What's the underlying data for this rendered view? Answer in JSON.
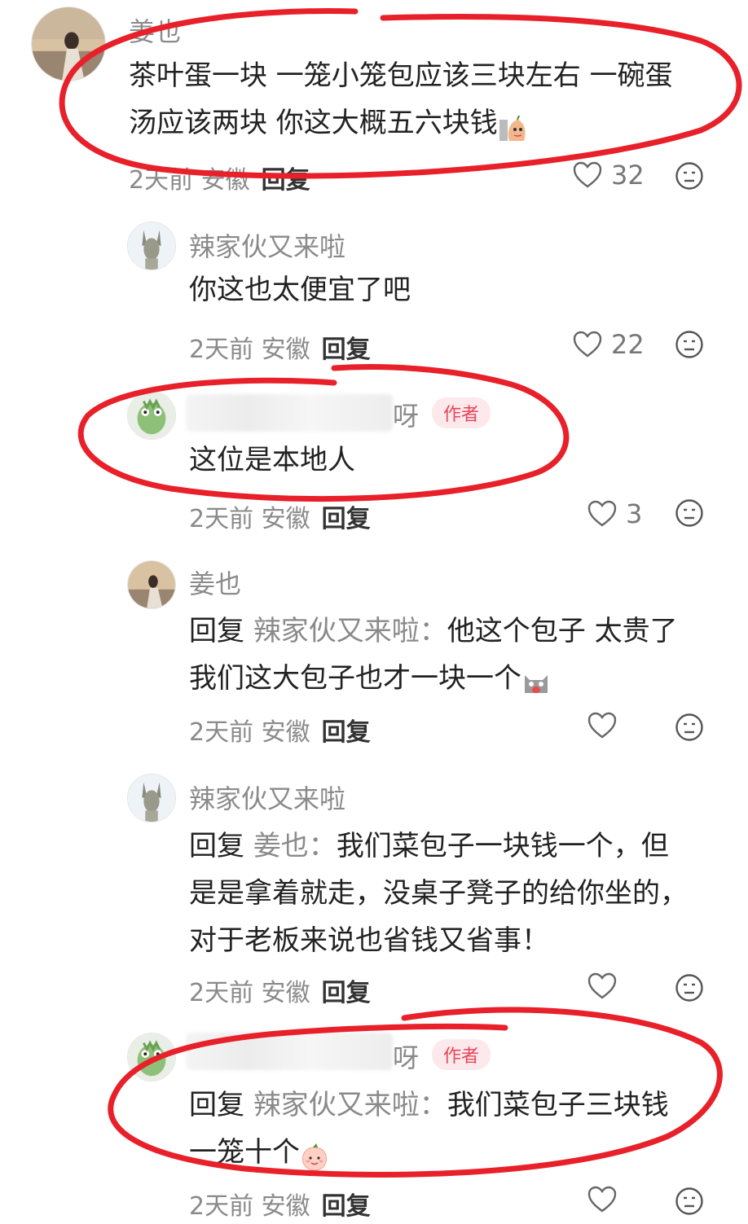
{
  "comments": [
    {
      "username": "姜也",
      "body": [
        "茶叶蛋一块 一笼小笼包应该三块左右 一碗蛋",
        "汤应该两块 你这大概五六块钱"
      ],
      "time": "2天前",
      "location": "安徽",
      "reply_label": "回复",
      "likes": "32",
      "emoji": "pear-emoji"
    },
    {
      "username": "辣家伙又来啦",
      "body": [
        "你这也太便宜了吧"
      ],
      "time": "2天前",
      "location": "安徽",
      "reply_label": "回复",
      "likes": "22"
    },
    {
      "username_suffix": "呀",
      "author_tag": "作者",
      "body": [
        "这位是本地人"
      ],
      "time": "2天前",
      "location": "安徽",
      "reply_label": "回复",
      "likes": "3"
    },
    {
      "username": "姜也",
      "reply_word": "回复",
      "reply_target": "辣家伙又来啦：",
      "body": [
        "他这个包子 太贵了",
        "我们这大包子也才一块一个"
      ],
      "time": "2天前",
      "location": "安徽",
      "reply_label": "回复",
      "likes": "",
      "emoji": "crying-cat-emoji"
    },
    {
      "username": "辣家伙又来啦",
      "reply_word": "回复",
      "reply_target": "姜也：",
      "body": [
        "我们菜包子一块钱一个，但",
        "是是拿着就走，没桌子凳子的给你坐的，",
        "对于老板来说也省钱又省事！"
      ],
      "time": "2天前",
      "location": "安徽",
      "reply_label": "回复",
      "likes": ""
    },
    {
      "username_suffix": "呀",
      "author_tag": "作者",
      "reply_word": "回复",
      "reply_target": "辣家伙又来啦：",
      "body": [
        "我们菜包子三块钱",
        "一笼十个"
      ],
      "time": "2天前",
      "location": "安徽",
      "reply_label": "回复",
      "likes": "",
      "emoji": "peach-emoji"
    }
  ],
  "colors": {
    "annotation_red": "#e8202a",
    "author_tag": "#e8455b",
    "muted_text": "#8a8a8a"
  }
}
